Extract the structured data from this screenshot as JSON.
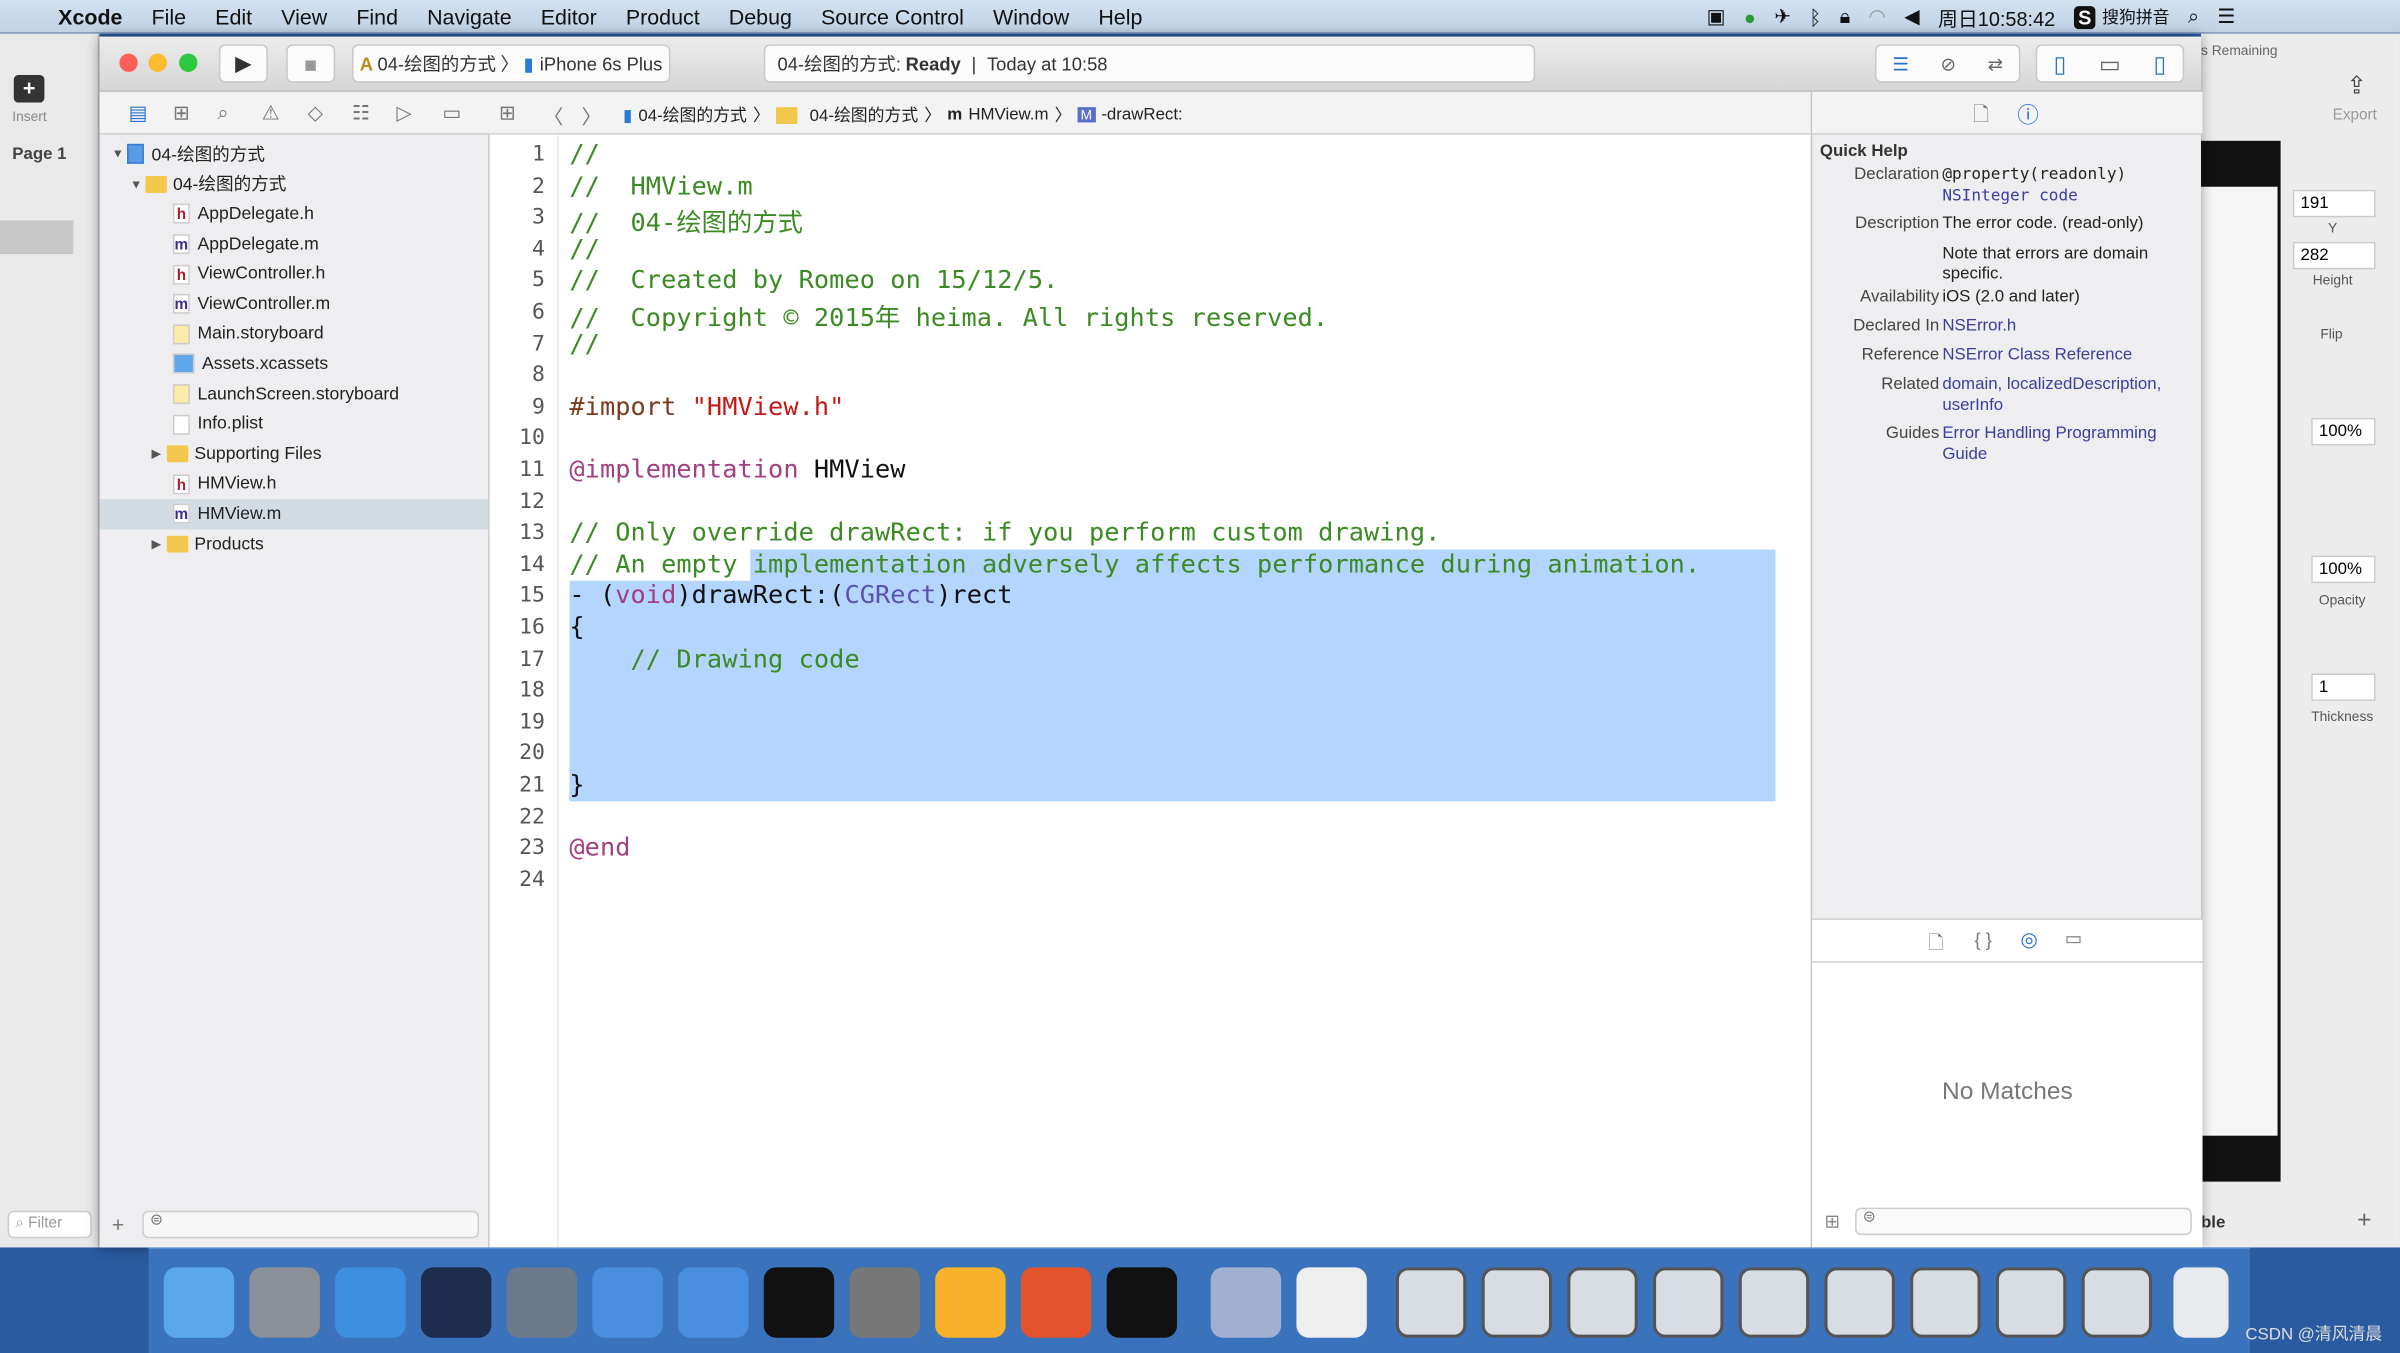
{
  "menubar": {
    "app": "Xcode",
    "items": [
      "File",
      "Edit",
      "View",
      "Find",
      "Navigate",
      "Editor",
      "Product",
      "Debug",
      "Source Control",
      "Window",
      "Help"
    ],
    "clock": "周日10:58:42",
    "ime": "搜狗拼音"
  },
  "toolbar": {
    "scheme": "04-绘图的方式",
    "device": "iPhone 6s Plus",
    "status_project": "04-绘图的方式:",
    "status_state": "Ready",
    "status_time": "Today at 10:58"
  },
  "jumpbar": [
    "04-绘图的方式",
    "04-绘图的方式",
    "HMView.m",
    "-drawRect:"
  ],
  "sketch": {
    "page": "Page 1",
    "insert": "Insert",
    "export": "Export",
    "remaining": "s Remaining",
    "y_value": "191",
    "y_label": "Y",
    "height_value": "282",
    "height_label": "Height",
    "flip_label": "Flip",
    "pct1": "100%",
    "opacity_value": "100%",
    "opacity_label": "Opacity",
    "thickness_value": "1",
    "thickness_label": "Thickness",
    "filter": "Filter",
    "table_label": "ble"
  },
  "navigator": {
    "items": [
      {
        "label": "04-绘图的方式",
        "icon": "project-icon",
        "level": 0,
        "expanded": true
      },
      {
        "label": "04-绘图的方式",
        "icon": "folder-icon",
        "level": 1,
        "expanded": true
      },
      {
        "label": "AppDelegate.h",
        "icon": "h"
      },
      {
        "label": "AppDelegate.m",
        "icon": "m"
      },
      {
        "label": "ViewController.h",
        "icon": "h"
      },
      {
        "label": "ViewController.m",
        "icon": "m"
      },
      {
        "label": "Main.storyboard",
        "icon": "storyboard"
      },
      {
        "label": "Assets.xcassets",
        "icon": "assets"
      },
      {
        "label": "LaunchScreen.storyboard",
        "icon": "storyboard"
      },
      {
        "label": "Info.plist",
        "icon": "plist"
      },
      {
        "label": "Supporting Files",
        "icon": "folder-icon",
        "collapsed": true
      },
      {
        "label": "HMView.h",
        "icon": "h"
      },
      {
        "label": "HMView.m",
        "icon": "m",
        "selected": true
      },
      {
        "label": "Products",
        "icon": "folder-icon",
        "collapsed": true
      }
    ]
  },
  "code": {
    "lines": [
      [
        [
          "//",
          "c"
        ]
      ],
      [
        [
          "//  HMView.m",
          "c"
        ]
      ],
      [
        [
          "//  04-绘图的方式",
          "c"
        ]
      ],
      [
        [
          "//",
          "c"
        ]
      ],
      [
        [
          "//  Created by Romeo on 15/12/5.",
          "c"
        ]
      ],
      [
        [
          "//  Copyright © 2015年 heima. All rights reserved.",
          "c"
        ]
      ],
      [
        [
          "//",
          "c"
        ]
      ],
      [],
      [
        [
          "#import ",
          "p"
        ],
        [
          "\"HMView.h\"",
          "s"
        ]
      ],
      [],
      [
        [
          "@implementation",
          "k"
        ],
        [
          " HMView",
          ""
        ]
      ],
      [],
      [
        [
          "// Only override drawRect: if you perform custom drawing.",
          "c"
        ]
      ],
      [
        [
          "// An empty implementation adversely affects performance during animation.",
          "c"
        ]
      ],
      [
        [
          "- (",
          ""
        ],
        [
          "void",
          "k"
        ],
        [
          ")drawRect:(",
          ""
        ],
        [
          "CGRect",
          "t"
        ],
        [
          ")rect",
          ""
        ]
      ],
      [
        [
          "{",
          ""
        ]
      ],
      [
        [
          "    // Drawing code",
          "c"
        ]
      ],
      [],
      [],
      [],
      [
        [
          "}",
          ""
        ]
      ],
      [],
      [
        [
          "@end",
          "k"
        ]
      ],
      []
    ]
  },
  "quick_help": {
    "title": "Quick Help",
    "rows": [
      {
        "label": "Declaration",
        "value": "@property(readonly)",
        "value2": "NSInteger code"
      },
      {
        "label": "Description",
        "value": "The error code. (read-only)",
        "value2": "Note that errors are domain specific."
      },
      {
        "label": "Availability",
        "value": "iOS (2.0 and later)"
      },
      {
        "label": "Declared In",
        "value": "NSError.h"
      },
      {
        "label": "Reference",
        "value": "NSError Class Reference"
      },
      {
        "label": "Related",
        "value": "domain, localizedDescription, userInfo"
      },
      {
        "label": "Guides",
        "value": "Error Handling Programming Guide"
      }
    ],
    "no_matches": "No Matches"
  },
  "watermark": "CSDN @清风清晨",
  "colors": {
    "selection": "#b4d5fe",
    "comment": "#3b8a23",
    "keyword": "#a23e82",
    "dock": "#3a73bb"
  }
}
